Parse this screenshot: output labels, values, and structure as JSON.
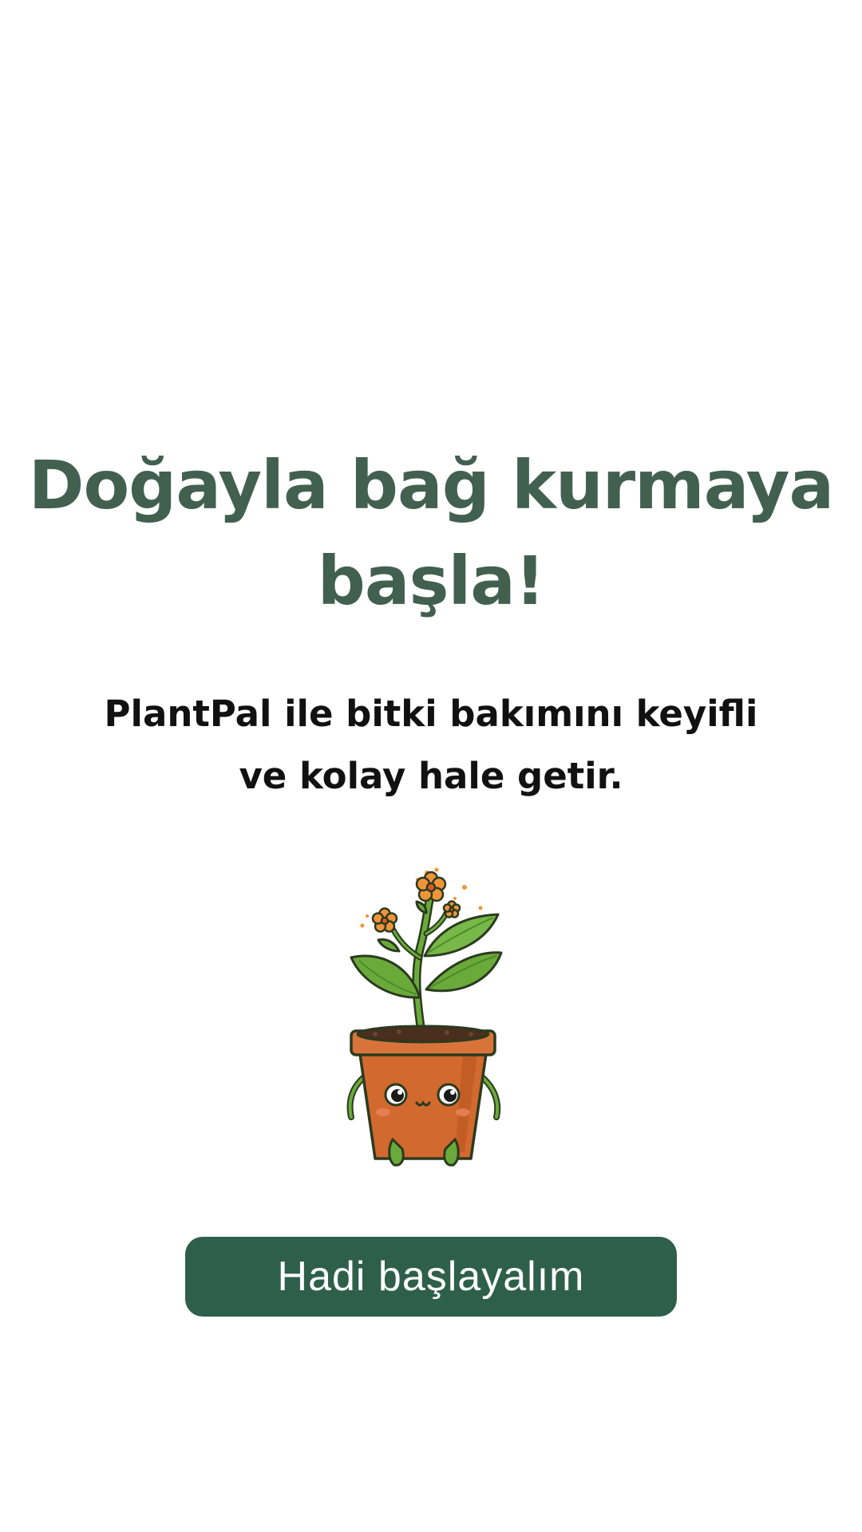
{
  "onboarding": {
    "headline_line1": "Doğayla bağ kurmaya",
    "headline_line2": "başla!",
    "subtitle_line1": "PlantPal ile bitki bakımını keyifli",
    "subtitle_line2": "ve kolay hale getir.",
    "illustration_icon": "potted-plant-mascot-icon",
    "cta_label": "Hadi başlayalım"
  },
  "colors": {
    "headline": "#42604f",
    "subtitle": "#111111",
    "button_bg": "#2e5f4b",
    "button_text": "#ffffff",
    "pot": "#d2692e",
    "leaf": "#6aaa3a",
    "flower": "#f0943a"
  }
}
